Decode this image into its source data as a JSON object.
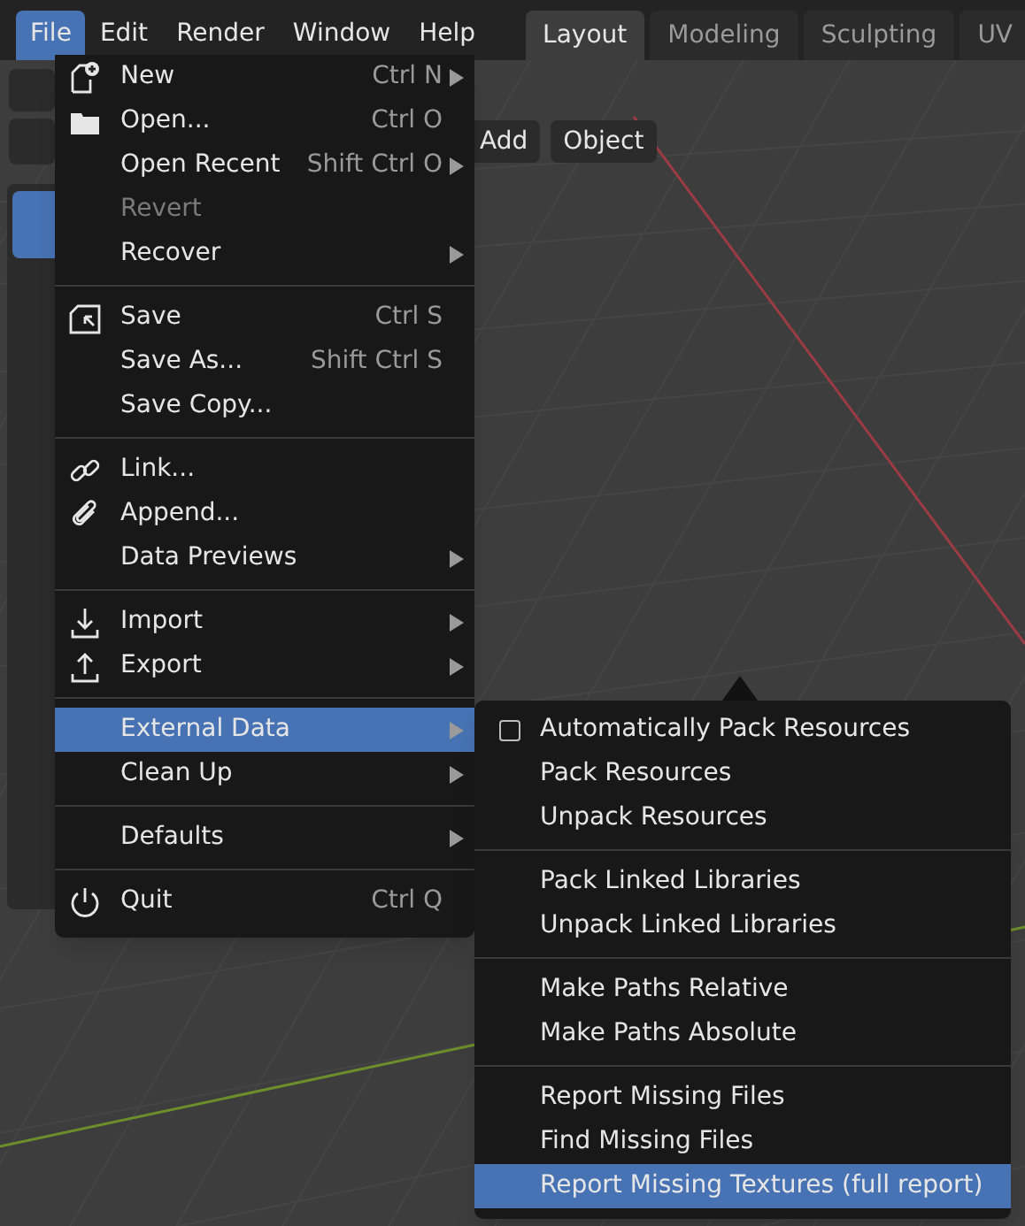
{
  "topbar": {
    "menus": [
      {
        "label": "File",
        "selected": true
      },
      {
        "label": "Edit",
        "selected": false
      },
      {
        "label": "Render",
        "selected": false
      },
      {
        "label": "Window",
        "selected": false
      },
      {
        "label": "Help",
        "selected": false
      }
    ],
    "workspaces": [
      {
        "label": "Layout",
        "selected": true
      },
      {
        "label": "Modeling",
        "selected": false
      },
      {
        "label": "Sculpting",
        "selected": false
      },
      {
        "label": "UV",
        "selected": false
      }
    ]
  },
  "viewport_header": {
    "buttons": [
      "Add",
      "Object"
    ]
  },
  "file_menu": {
    "groups": [
      {
        "items": [
          {
            "label": "New",
            "shortcut": "Ctrl N",
            "submenu": true,
            "disabled": false,
            "selected": false
          },
          {
            "label": "Open...",
            "shortcut": "Ctrl O",
            "submenu": false,
            "disabled": false,
            "selected": false
          },
          {
            "label": "Open Recent",
            "shortcut": "Shift Ctrl O",
            "submenu": true,
            "disabled": false,
            "selected": false
          },
          {
            "label": "Revert",
            "submenu": false,
            "disabled": true,
            "selected": false
          },
          {
            "label": "Recover",
            "submenu": true,
            "disabled": false,
            "selected": false
          }
        ]
      },
      {
        "items": [
          {
            "label": "Save",
            "shortcut": "Ctrl S",
            "submenu": false,
            "disabled": false,
            "selected": false
          },
          {
            "label": "Save As...",
            "shortcut": "Shift Ctrl S",
            "submenu": false,
            "disabled": false,
            "selected": false
          },
          {
            "label": "Save Copy...",
            "submenu": false,
            "disabled": false,
            "selected": false
          }
        ]
      },
      {
        "items": [
          {
            "label": "Link...",
            "submenu": false,
            "disabled": false,
            "selected": false
          },
          {
            "label": "Append...",
            "submenu": false,
            "disabled": false,
            "selected": false
          },
          {
            "label": "Data Previews",
            "submenu": true,
            "disabled": false,
            "selected": false
          }
        ]
      },
      {
        "items": [
          {
            "label": "Import",
            "submenu": true,
            "disabled": false,
            "selected": false
          },
          {
            "label": "Export",
            "submenu": true,
            "disabled": false,
            "selected": false
          }
        ]
      },
      {
        "items": [
          {
            "label": "External Data",
            "submenu": true,
            "disabled": false,
            "selected": true
          },
          {
            "label": "Clean Up",
            "submenu": true,
            "disabled": false,
            "selected": false
          }
        ]
      },
      {
        "items": [
          {
            "label": "Defaults",
            "submenu": true,
            "disabled": false,
            "selected": false
          }
        ]
      },
      {
        "items": [
          {
            "label": "Quit",
            "shortcut": "Ctrl Q",
            "submenu": false,
            "disabled": false,
            "selected": false
          }
        ]
      }
    ]
  },
  "external_data_menu": {
    "groups": [
      {
        "items": [
          {
            "kind": "checkbox",
            "label": "Automatically Pack Resources",
            "checked": false,
            "selected": false
          },
          {
            "kind": "action",
            "label": "Pack Resources",
            "selected": false
          },
          {
            "kind": "action",
            "label": "Unpack Resources",
            "selected": false
          }
        ]
      },
      {
        "items": [
          {
            "kind": "action",
            "label": "Pack Linked Libraries",
            "selected": false
          },
          {
            "kind": "action",
            "label": "Unpack Linked Libraries",
            "selected": false
          }
        ]
      },
      {
        "items": [
          {
            "kind": "action",
            "label": "Make Paths Relative",
            "selected": false
          },
          {
            "kind": "action",
            "label": "Make Paths Absolute",
            "selected": false
          }
        ]
      },
      {
        "items": [
          {
            "kind": "action",
            "label": "Report Missing Files",
            "selected": false
          },
          {
            "kind": "action",
            "label": "Find Missing Files",
            "selected": false
          },
          {
            "kind": "action",
            "label": "Report Missing Textures (full report)",
            "selected": true
          }
        ]
      }
    ]
  }
}
